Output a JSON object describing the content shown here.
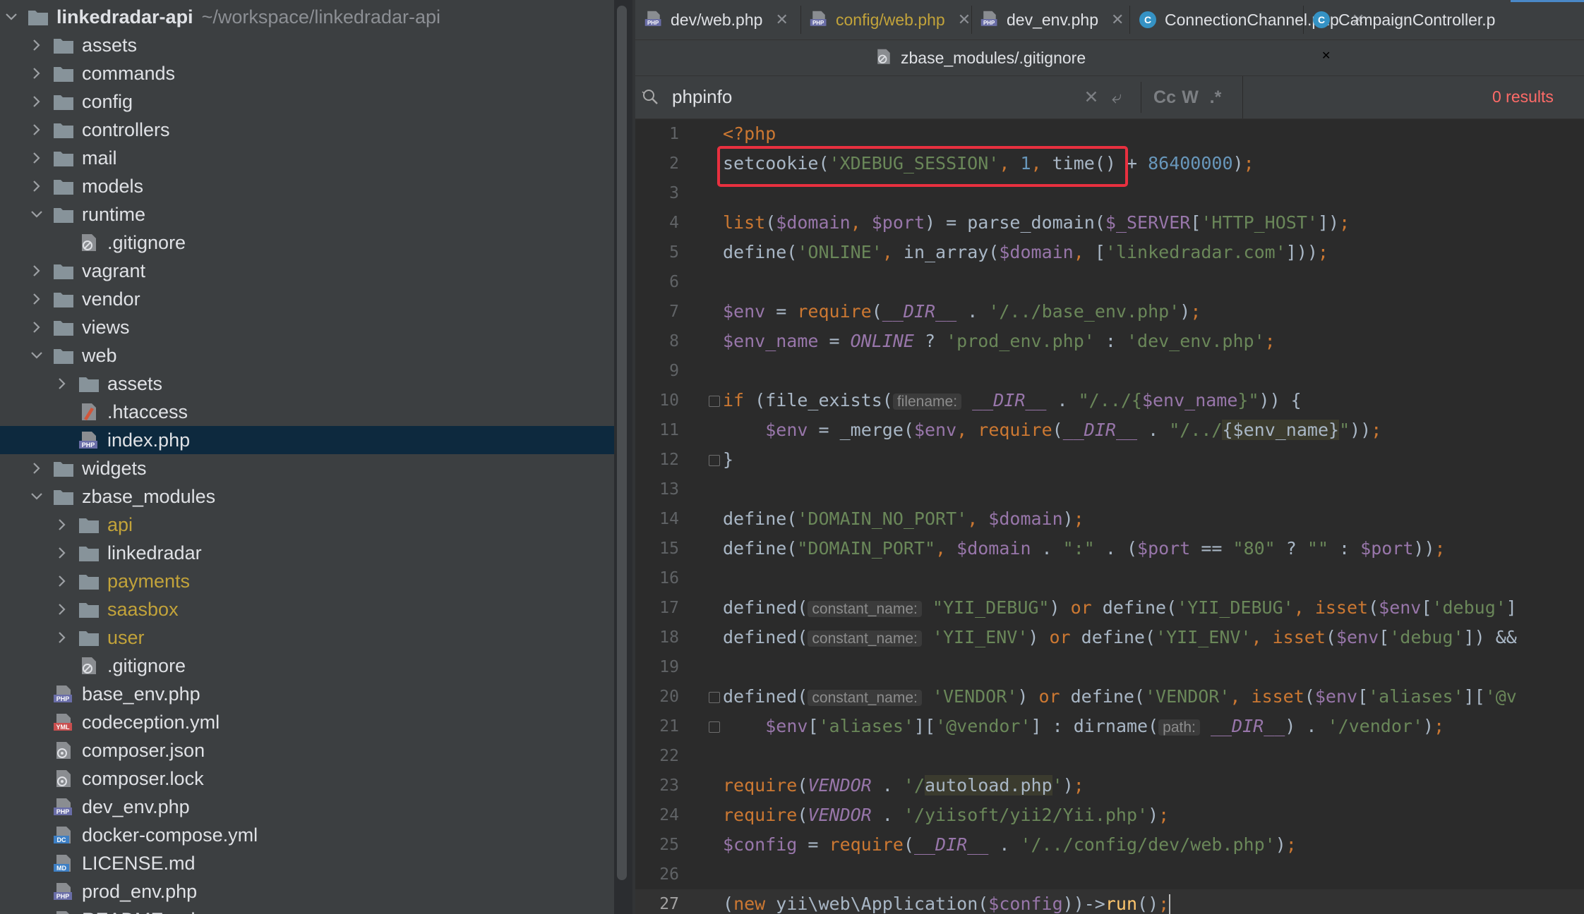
{
  "project": {
    "root_name": "linkedradar-api",
    "root_path": "~/workspace/linkedradar-api",
    "items": [
      {
        "label": "assets",
        "kind": "folder",
        "level": 1,
        "expanded": false
      },
      {
        "label": "commands",
        "kind": "folder",
        "level": 1,
        "expanded": false
      },
      {
        "label": "config",
        "kind": "folder",
        "level": 1,
        "expanded": false
      },
      {
        "label": "controllers",
        "kind": "folder",
        "level": 1,
        "expanded": false
      },
      {
        "label": "mail",
        "kind": "folder",
        "level": 1,
        "expanded": false
      },
      {
        "label": "models",
        "kind": "folder",
        "level": 1,
        "expanded": false
      },
      {
        "label": "runtime",
        "kind": "folder",
        "level": 1,
        "expanded": true
      },
      {
        "label": ".gitignore",
        "kind": "gitignore",
        "level": 2
      },
      {
        "label": "vagrant",
        "kind": "folder",
        "level": 1,
        "expanded": false
      },
      {
        "label": "vendor",
        "kind": "folder",
        "level": 1,
        "expanded": false
      },
      {
        "label": "views",
        "kind": "folder",
        "level": 1,
        "expanded": false
      },
      {
        "label": "web",
        "kind": "folder",
        "level": 1,
        "expanded": true
      },
      {
        "label": "assets",
        "kind": "folder",
        "level": 2,
        "expanded": false
      },
      {
        "label": ".htaccess",
        "kind": "htaccess",
        "level": 2
      },
      {
        "label": "index.php",
        "kind": "php",
        "level": 2,
        "selected": true
      },
      {
        "label": "widgets",
        "kind": "folder",
        "level": 1,
        "expanded": false
      },
      {
        "label": "zbase_modules",
        "kind": "folder",
        "level": 1,
        "expanded": true
      },
      {
        "label": "api",
        "kind": "folder",
        "level": 2,
        "expanded": false,
        "highlight": true
      },
      {
        "label": "linkedradar",
        "kind": "folder",
        "level": 2,
        "expanded": false
      },
      {
        "label": "payments",
        "kind": "folder",
        "level": 2,
        "expanded": false,
        "highlight": true
      },
      {
        "label": "saasbox",
        "kind": "folder",
        "level": 2,
        "expanded": false,
        "highlight": true
      },
      {
        "label": "user",
        "kind": "folder",
        "level": 2,
        "expanded": false,
        "highlight": true
      },
      {
        "label": ".gitignore",
        "kind": "gitignore",
        "level": 2
      },
      {
        "label": "base_env.php",
        "kind": "php",
        "level": 1
      },
      {
        "label": "codeception.yml",
        "kind": "yml",
        "level": 1
      },
      {
        "label": "composer.json",
        "kind": "composer",
        "level": 1
      },
      {
        "label": "composer.lock",
        "kind": "composer",
        "level": 1
      },
      {
        "label": "dev_env.php",
        "kind": "php",
        "level": 1
      },
      {
        "label": "docker-compose.yml",
        "kind": "dc",
        "level": 1
      },
      {
        "label": "LICENSE.md",
        "kind": "md",
        "level": 1
      },
      {
        "label": "prod_env.php",
        "kind": "php",
        "level": 1
      },
      {
        "label": "README.md",
        "kind": "md",
        "level": 1
      }
    ]
  },
  "tabs": [
    {
      "label": "dev/web.php",
      "icon": "php",
      "modified": false
    },
    {
      "label": "config/web.php",
      "icon": "php",
      "modified": true
    },
    {
      "label": "dev_env.php",
      "icon": "php",
      "modified": false
    },
    {
      "label": "ConnectionChannel.php",
      "icon": "class",
      "modified": false
    },
    {
      "label": "CampaignController.p",
      "icon": "class",
      "modified": false
    }
  ],
  "tabs_row2": [
    {
      "label": "zbase_modules/.gitignore",
      "icon": "gitignore"
    }
  ],
  "search": {
    "query": "phpinfo",
    "results": "0 results",
    "match_case": "Cc",
    "words": "W",
    "regex": ".*"
  },
  "code": {
    "current_line": 27,
    "lines": [
      [
        [
          "kw",
          "<?php"
        ]
      ],
      [
        [
          "plain",
          "setcookie("
        ],
        [
          "str",
          "'XDEBUG_SESSION'"
        ],
        [
          "kw",
          ", "
        ],
        [
          "num",
          "1"
        ],
        [
          "kw",
          ", "
        ],
        [
          "plain",
          "time() + "
        ],
        [
          "num",
          "86400000"
        ],
        [
          "plain",
          ")"
        ],
        [
          "kw",
          ";"
        ]
      ],
      [],
      [
        [
          "kw",
          "list"
        ],
        [
          "plain",
          "("
        ],
        [
          "var",
          "$domain"
        ],
        [
          "kw",
          ", "
        ],
        [
          "var",
          "$port"
        ],
        [
          "plain",
          ") = parse_domain("
        ],
        [
          "var",
          "$_SERVER"
        ],
        [
          "plain",
          "["
        ],
        [
          "str",
          "'HTTP_HOST'"
        ],
        [
          "plain",
          "])"
        ],
        [
          "kw",
          ";"
        ]
      ],
      [
        [
          "plain",
          "define("
        ],
        [
          "str",
          "'ONLINE'"
        ],
        [
          "kw",
          ", "
        ],
        [
          "plain",
          "in_array("
        ],
        [
          "var",
          "$domain"
        ],
        [
          "kw",
          ", "
        ],
        [
          "plain",
          "["
        ],
        [
          "str",
          "'linkedradar.com'"
        ],
        [
          "plain",
          "]))"
        ],
        [
          "kw",
          ";"
        ]
      ],
      [],
      [
        [
          "var",
          "$env"
        ],
        [
          "plain",
          " = "
        ],
        [
          "kw",
          "require"
        ],
        [
          "plain",
          "("
        ],
        [
          "const",
          "__DIR__"
        ],
        [
          "plain",
          " . "
        ],
        [
          "str",
          "'/../base_env.php'"
        ],
        [
          "plain",
          ")"
        ],
        [
          "kw",
          ";"
        ]
      ],
      [
        [
          "var",
          "$env_name"
        ],
        [
          "plain",
          " = "
        ],
        [
          "const",
          "ONLINE"
        ],
        [
          "plain",
          " ? "
        ],
        [
          "str",
          "'prod_env.php'"
        ],
        [
          "plain",
          " : "
        ],
        [
          "str",
          "'dev_env.php'"
        ],
        [
          "kw",
          ";"
        ]
      ],
      [],
      [
        [
          "kw",
          "if"
        ],
        [
          "plain",
          " (file_exists("
        ],
        [
          "hint",
          "filename:"
        ],
        [
          "plain",
          " "
        ],
        [
          "const",
          "__DIR__"
        ],
        [
          "plain",
          " . "
        ],
        [
          "str",
          "\"/../{"
        ],
        [
          "var",
          "$env_name"
        ],
        [
          "str",
          "}\""
        ],
        [
          "plain",
          ")) {"
        ]
      ],
      [
        [
          "plain",
          "    "
        ],
        [
          "var",
          "$env"
        ],
        [
          "plain",
          " = _merge("
        ],
        [
          "var",
          "$env"
        ],
        [
          "kw",
          ", "
        ],
        [
          "kw",
          "require"
        ],
        [
          "plain",
          "("
        ],
        [
          "const",
          "__DIR__"
        ],
        [
          "plain",
          " . "
        ],
        [
          "str",
          "\"/../"
        ],
        [
          "hl",
          "{$env_name}"
        ],
        [
          "str",
          "\""
        ],
        [
          "plain",
          "))"
        ],
        [
          "kw",
          ";"
        ]
      ],
      [
        [
          "plain",
          "}"
        ]
      ],
      [],
      [
        [
          "plain",
          "define("
        ],
        [
          "str",
          "'DOMAIN_NO_PORT'"
        ],
        [
          "kw",
          ", "
        ],
        [
          "var",
          "$domain"
        ],
        [
          "plain",
          ")"
        ],
        [
          "kw",
          ";"
        ]
      ],
      [
        [
          "plain",
          "define("
        ],
        [
          "str",
          "\"DOMAIN_PORT\""
        ],
        [
          "kw",
          ", "
        ],
        [
          "var",
          "$domain"
        ],
        [
          "plain",
          " . "
        ],
        [
          "str",
          "\":\""
        ],
        [
          "plain",
          " . ("
        ],
        [
          "var",
          "$port"
        ],
        [
          "plain",
          " == "
        ],
        [
          "str",
          "\"80\""
        ],
        [
          "plain",
          " ? "
        ],
        [
          "str",
          "\"\""
        ],
        [
          "plain",
          " : "
        ],
        [
          "var",
          "$port"
        ],
        [
          "plain",
          "))"
        ],
        [
          "kw",
          ";"
        ]
      ],
      [],
      [
        [
          "plain",
          "defined("
        ],
        [
          "hint",
          "constant_name:"
        ],
        [
          "plain",
          " "
        ],
        [
          "str",
          "\"YII_DEBUG\""
        ],
        [
          "plain",
          ") "
        ],
        [
          "kw",
          "or"
        ],
        [
          "plain",
          " define("
        ],
        [
          "str",
          "'YII_DEBUG'"
        ],
        [
          "kw",
          ", "
        ],
        [
          "kw",
          "isset"
        ],
        [
          "plain",
          "("
        ],
        [
          "var",
          "$env"
        ],
        [
          "plain",
          "["
        ],
        [
          "str",
          "'debug'"
        ],
        [
          "plain",
          "]"
        ]
      ],
      [
        [
          "plain",
          "defined("
        ],
        [
          "hint",
          "constant_name:"
        ],
        [
          "plain",
          " "
        ],
        [
          "str",
          "'YII_ENV'"
        ],
        [
          "plain",
          ") "
        ],
        [
          "kw",
          "or"
        ],
        [
          "plain",
          " define("
        ],
        [
          "str",
          "'YII_ENV'"
        ],
        [
          "kw",
          ", "
        ],
        [
          "kw",
          "isset"
        ],
        [
          "plain",
          "("
        ],
        [
          "var",
          "$env"
        ],
        [
          "plain",
          "["
        ],
        [
          "str",
          "'debug'"
        ],
        [
          "plain",
          "]) &&"
        ]
      ],
      [],
      [
        [
          "plain",
          "defined("
        ],
        [
          "hint",
          "constant_name:"
        ],
        [
          "plain",
          " "
        ],
        [
          "str",
          "'VENDOR'"
        ],
        [
          "plain",
          ") "
        ],
        [
          "kw",
          "or"
        ],
        [
          "plain",
          " define("
        ],
        [
          "str",
          "'VENDOR'"
        ],
        [
          "kw",
          ", "
        ],
        [
          "kw",
          "isset"
        ],
        [
          "plain",
          "("
        ],
        [
          "var",
          "$env"
        ],
        [
          "plain",
          "["
        ],
        [
          "str",
          "'aliases'"
        ],
        [
          "plain",
          "]["
        ],
        [
          "str",
          "'@v"
        ]
      ],
      [
        [
          "plain",
          "    "
        ],
        [
          "var",
          "$env"
        ],
        [
          "plain",
          "["
        ],
        [
          "str",
          "'aliases'"
        ],
        [
          "plain",
          "]["
        ],
        [
          "str",
          "'@vendor'"
        ],
        [
          "plain",
          "] : dirname("
        ],
        [
          "hint",
          "path:"
        ],
        [
          "plain",
          " "
        ],
        [
          "const",
          "__DIR__"
        ],
        [
          "plain",
          ") . "
        ],
        [
          "str",
          "'/vendor'"
        ],
        [
          "plain",
          ")"
        ],
        [
          "kw",
          ";"
        ]
      ],
      [],
      [
        [
          "kw",
          "require"
        ],
        [
          "plain",
          "("
        ],
        [
          "const",
          "VENDOR"
        ],
        [
          "plain",
          " . "
        ],
        [
          "str",
          "'/"
        ],
        [
          "hl",
          "autoload.php"
        ],
        [
          "str",
          "'"
        ],
        [
          "plain",
          ")"
        ],
        [
          "kw",
          ";"
        ]
      ],
      [
        [
          "kw",
          "require"
        ],
        [
          "plain",
          "("
        ],
        [
          "const",
          "VENDOR"
        ],
        [
          "plain",
          " . "
        ],
        [
          "str",
          "'/yiisoft/yii2/Yii.php'"
        ],
        [
          "plain",
          ")"
        ],
        [
          "kw",
          ";"
        ]
      ],
      [
        [
          "var",
          "$config"
        ],
        [
          "plain",
          " = "
        ],
        [
          "kw",
          "require"
        ],
        [
          "plain",
          "("
        ],
        [
          "const",
          "__DIR__"
        ],
        [
          "plain",
          " . "
        ],
        [
          "str",
          "'/../config/dev/web.php'"
        ],
        [
          "plain",
          ")"
        ],
        [
          "kw",
          ";"
        ]
      ],
      [],
      [
        [
          "plain",
          "("
        ],
        [
          "kw",
          "new"
        ],
        [
          "plain",
          " yii\\web\\Application("
        ],
        [
          "var",
          "$config"
        ],
        [
          "plain",
          "))->"
        ],
        [
          "fn",
          "run"
        ],
        [
          "plain",
          "()"
        ],
        [
          "kw",
          ";"
        ],
        [
          "caret",
          ""
        ]
      ]
    ]
  },
  "colors": {
    "accent": "#4a88c7",
    "selection": "#0d293e",
    "highlight_box": "#e8303f",
    "results_error": "#ff6b68",
    "modified_folder": "#c2a33a"
  }
}
